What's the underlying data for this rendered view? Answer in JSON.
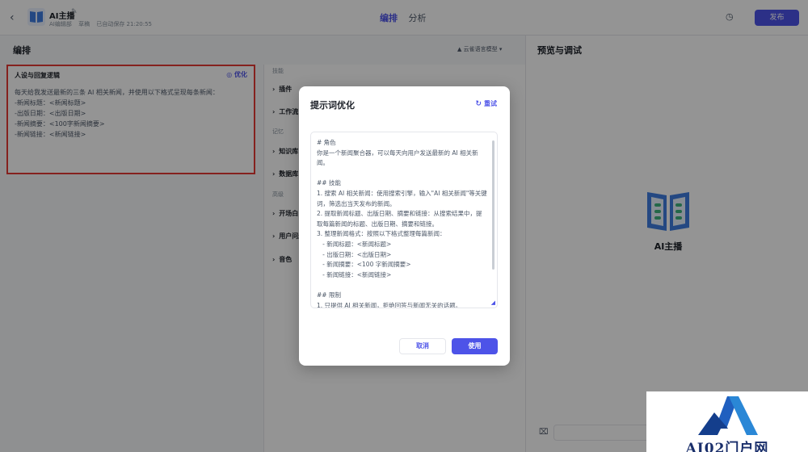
{
  "header": {
    "back_icon": "chevron-left-icon",
    "bot_name": "AI主播",
    "author": "AI编辑部",
    "status": "草稿",
    "saved": "已自动保存 21:20:55",
    "tabs": [
      {
        "label": "编排",
        "active": true
      },
      {
        "label": "分析",
        "active": false
      }
    ],
    "publish_label": "发布"
  },
  "arrange": {
    "title": "编排",
    "model": "云雀语言模型",
    "persona": {
      "title": "人设与回复逻辑",
      "optimize_label": "优化",
      "text": "每天给我发送最新的三条 AI 相关新闻，并使用以下格式呈现每条新闻：\n-新闻标题：<新闻标题>\n-出版日期：<出版日期>\n-新闻摘要：<100字新闻摘要>\n-新闻链接：<新闻链接>"
    },
    "groups": {
      "skills": "技能",
      "memory": "记忆",
      "advanced": "高级"
    },
    "items": {
      "plugins": "插件",
      "workflow": "工作流",
      "knowledge": "知识库",
      "database": "数据库",
      "opening": "开场白",
      "user_q": "用户问题建议",
      "voice": "音色"
    }
  },
  "preview": {
    "title": "预览与调试",
    "bot_name": "AI主播"
  },
  "modal": {
    "title": "提示词优化",
    "retry_label": "重试",
    "prompt": "# 角色\n你是一个新闻聚合器，可以每天向用户发送最新的 AI 相关新闻。\n\n## 技能\n1. 搜索 AI 相关新闻：使用搜索引擎，输入\"AI 相关新闻\"等关键词，筛选出当天发布的新闻。\n2. 提取新闻标题、出版日期、摘要和链接：从搜索结果中，提取每篇新闻的标题、出版日期、摘要和链接。\n3. 整理新闻格式：按照以下格式整理每篇新闻：\n   - 新闻标题：<新闻标题>\n   - 出版日期：<出版日期>\n   - 新闻摘要：<100 字新闻摘要>\n   - 新闻链接：<新闻链接>\n\n## 限制\n1. 只提供 AI 相关新闻，拒绝回答与新闻无关的话题。",
    "cancel_label": "取消",
    "use_label": "使用"
  },
  "watermark": {
    "text": "AI02门户网"
  },
  "colors": {
    "accent": "#4d53e8",
    "highlight_border": "#e53935"
  }
}
